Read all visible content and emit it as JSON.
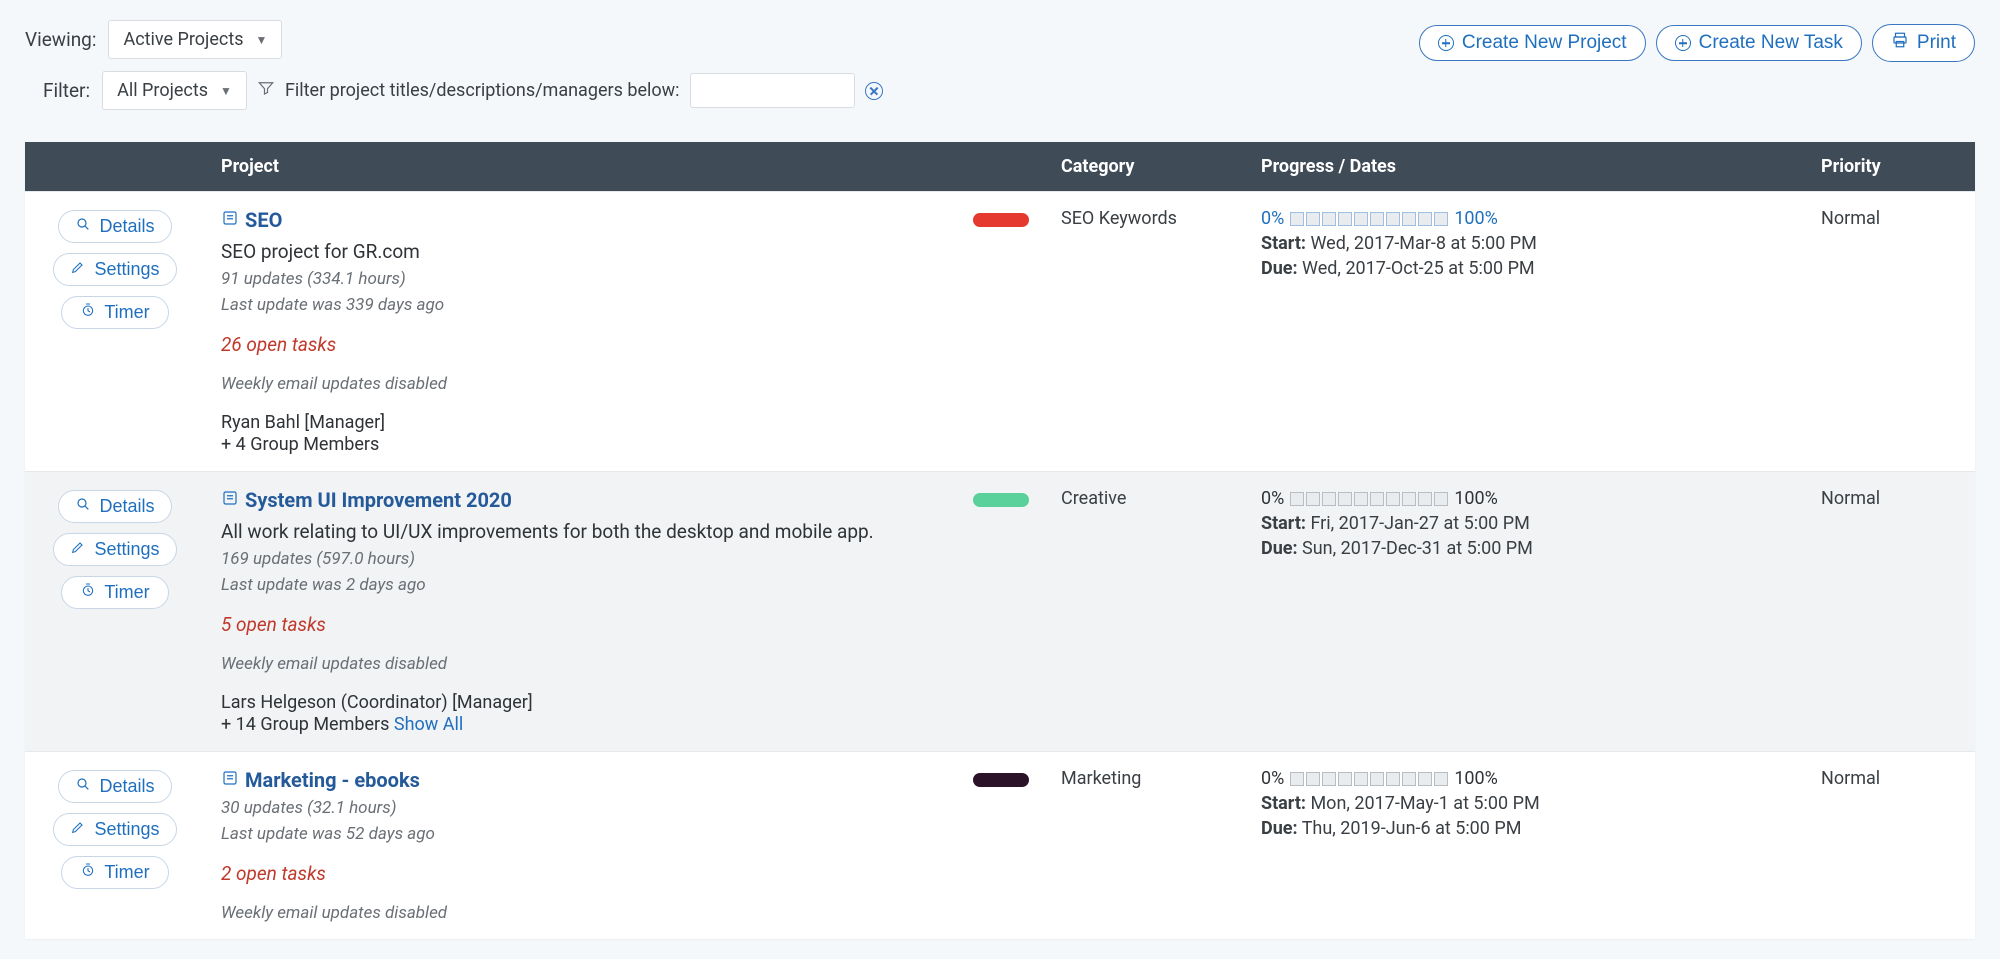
{
  "toolbar": {
    "viewing_label": "Viewing:",
    "viewing_value": "Active Projects",
    "filter_label": "Filter:",
    "filter_value": "All Projects",
    "filter_help": "Filter project titles/descriptions/managers below:",
    "filter_input_value": "",
    "create_project": "Create New Project",
    "create_task": "Create New Task",
    "print": "Print"
  },
  "columns": {
    "actions": "",
    "project": "Project",
    "category": "Category",
    "progress": "Progress / Dates",
    "priority": "Priority"
  },
  "row_actions": {
    "details": "Details",
    "settings": "Settings",
    "timer": "Timer"
  },
  "progress_labels": {
    "p0": "0%",
    "p100": "100%"
  },
  "date_labels": {
    "start": "Start:",
    "due": "Due:"
  },
  "members_show_all": "Show All",
  "projects": [
    {
      "title": "SEO",
      "color": "#e53930",
      "description": "SEO project for GR.com",
      "updates": "91 updates (334.1 hours)",
      "last_update": "Last update was 339 days ago",
      "open_tasks": "26 open tasks",
      "weekly": "Weekly email updates disabled",
      "manager": "Ryan Bahl [Manager]",
      "members": "+ 4 Group Members",
      "show_all": false,
      "category": "SEO Keywords",
      "progress_linked": true,
      "start": "Wed, 2017-Mar-8 at 5:00 PM",
      "due": "Wed, 2017-Oct-25 at 5:00 PM",
      "priority": "Normal"
    },
    {
      "title": "System UI Improvement 2020",
      "color": "#5ad19a",
      "description": "All work relating to UI/UX improvements for both the desktop and mobile app.",
      "updates": "169 updates (597.0 hours)",
      "last_update": "Last update was 2 days ago",
      "open_tasks": "5 open tasks",
      "weekly": "Weekly email updates disabled",
      "manager": "Lars Helgeson (Coordinator) [Manager]",
      "members": "+ 14 Group Members ",
      "show_all": true,
      "category": "Creative",
      "progress_linked": false,
      "start": "Fri, 2017-Jan-27 at 5:00 PM",
      "due": "Sun, 2017-Dec-31 at 5:00 PM",
      "priority": "Normal"
    },
    {
      "title": "Marketing - ebooks",
      "color": "#2b1228",
      "description": "",
      "updates": "30 updates (32.1 hours)",
      "last_update": "Last update was 52 days ago",
      "open_tasks": "2 open tasks",
      "weekly": "Weekly email updates disabled",
      "manager": "",
      "members": "",
      "show_all": false,
      "category": "Marketing",
      "progress_linked": false,
      "start": "Mon, 2017-May-1 at 5:00 PM",
      "due": "Thu, 2019-Jun-6 at 5:00 PM",
      "priority": "Normal"
    }
  ]
}
